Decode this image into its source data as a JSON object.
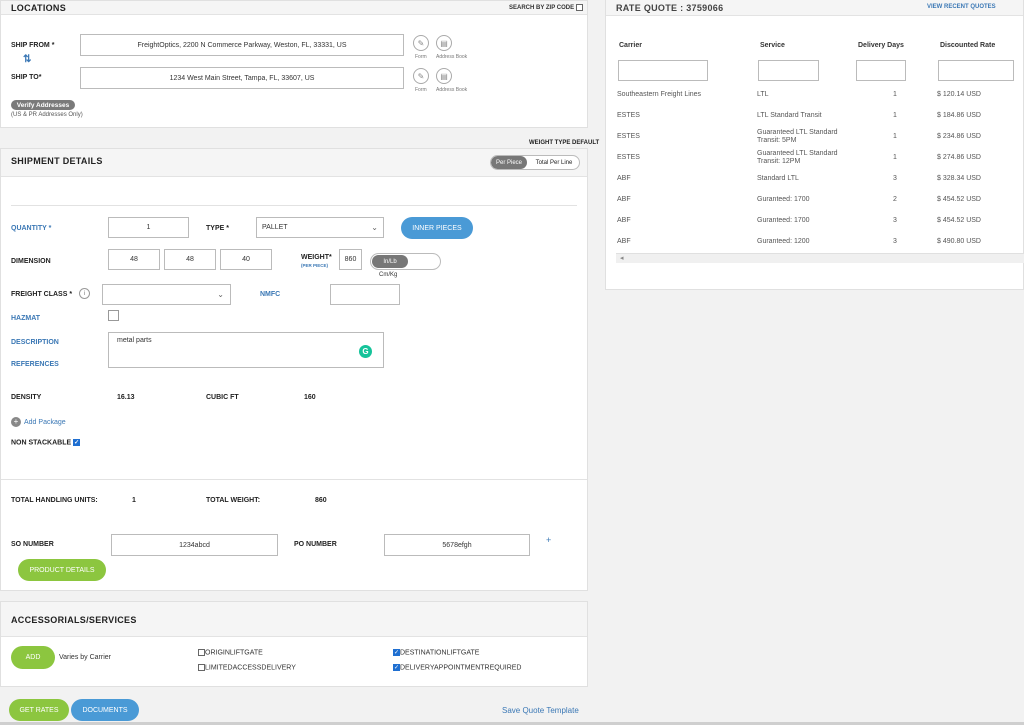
{
  "locations": {
    "title": "LOCATIONS",
    "search_zip_label": "SEARCH BY ZIP CODE",
    "ship_from_label": "SHIP FROM *",
    "ship_from_value": "FreightOptics, 2200 N Commerce Parkway, Weston, FL, 33331, US",
    "ship_to_label": "SHIP TO*",
    "ship_to_value": "1234 West Main Street, Tampa, FL, 33607, US",
    "form_label": "Form",
    "address_book_label": "Address Book",
    "verify_button": "Verify Addresses",
    "verify_note": "(US & PR Addresses Only)"
  },
  "shipment": {
    "weight_type_label": "WEIGHT TYPE DEFAULT",
    "title": "SHIPMENT DETAILS",
    "toggle_per_piece": "Per Piece",
    "toggle_total_per_line": "Total Per Line",
    "quantity_label": "QUANTITY *",
    "quantity_value": "1",
    "type_label": "TYPE *",
    "type_value": "PALLET",
    "inner_pieces_button": "INNER PIECES",
    "dimension_label": "DIMENSION",
    "dim_l": "48",
    "dim_w": "48",
    "dim_h": "40",
    "weight_label": "WEIGHT*",
    "weight_sub": "(PER PIECE)",
    "weight_value": "860",
    "unit_inlb": "In/Lb",
    "unit_cmkg": "Cm/Kg",
    "freight_class_label": "FREIGHT CLASS *",
    "nmfc_label": "NMFC",
    "hazmat_label": "HAZMAT",
    "description_label": "DESCRIPTION",
    "description_value": "metal parts",
    "references_label": "REFERENCES",
    "density_label": "DENSITY",
    "density_value": "16.13",
    "cubic_ft_label": "CUBIC FT",
    "cubic_ft_value": "160",
    "add_package": "Add Package",
    "non_stackable_label": "NON STACKABLE",
    "total_handling_label": "TOTAL HANDLING UNITS:",
    "total_handling_value": "1",
    "total_weight_label": "TOTAL WEIGHT:",
    "total_weight_value": "860",
    "so_number_label": "SO NUMBER",
    "so_number_value": "1234abcd",
    "po_number_label": "PO NUMBER",
    "po_number_value": "5678efgh",
    "plus": "+",
    "product_details_button": "PRODUCT DETAILS"
  },
  "accessorials": {
    "title": "ACCESSORIALS/SERVICES",
    "add_button": "ADD",
    "varies_note": "Varies by Carrier",
    "options": [
      {
        "label": "ORIGINLIFTGATE",
        "checked": false
      },
      {
        "label": "LIMITEDACCESSDELIVERY",
        "checked": false
      },
      {
        "label": "DESTINATIONLIFTGATE",
        "checked": true
      },
      {
        "label": "DELIVERYAPPOINTMENTREQUIRED",
        "checked": true
      }
    ]
  },
  "footer": {
    "get_rates": "GET RATES",
    "documents": "DOCUMENTS",
    "save_template": "Save Quote Template"
  },
  "rate_quote": {
    "title": "RATE QUOTE : 3759066",
    "view_recent": "VIEW RECENT QUOTES",
    "columns": [
      "Carrier",
      "Service",
      "Delivery Days",
      "Discounted Rate"
    ],
    "rows": [
      {
        "carrier": "Southeastern Freight Lines",
        "service": "LTL",
        "days": "1",
        "rate": "$ 120.14 USD"
      },
      {
        "carrier": "ESTES",
        "service": "LTL Standard Transit",
        "days": "1",
        "rate": "$ 184.86 USD"
      },
      {
        "carrier": "ESTES",
        "service": "Guaranteed LTL Standard Transit: 5PM",
        "days": "1",
        "rate": "$ 234.86 USD"
      },
      {
        "carrier": "ESTES",
        "service": "Guaranteed LTL Standard Transit: 12PM",
        "days": "1",
        "rate": "$ 274.86 USD"
      },
      {
        "carrier": "ABF",
        "service": "Standard LTL",
        "days": "3",
        "rate": "$ 328.34 USD"
      },
      {
        "carrier": "ABF",
        "service": "Guranteed: 1700",
        "days": "2",
        "rate": "$ 454.52 USD"
      },
      {
        "carrier": "ABF",
        "service": "Guranteed: 1700",
        "days": "3",
        "rate": "$ 454.52 USD"
      },
      {
        "carrier": "ABF",
        "service": "Guranteed: 1200",
        "days": "3",
        "rate": "$ 490.80 USD"
      }
    ],
    "scroll_arrow": "◂"
  }
}
